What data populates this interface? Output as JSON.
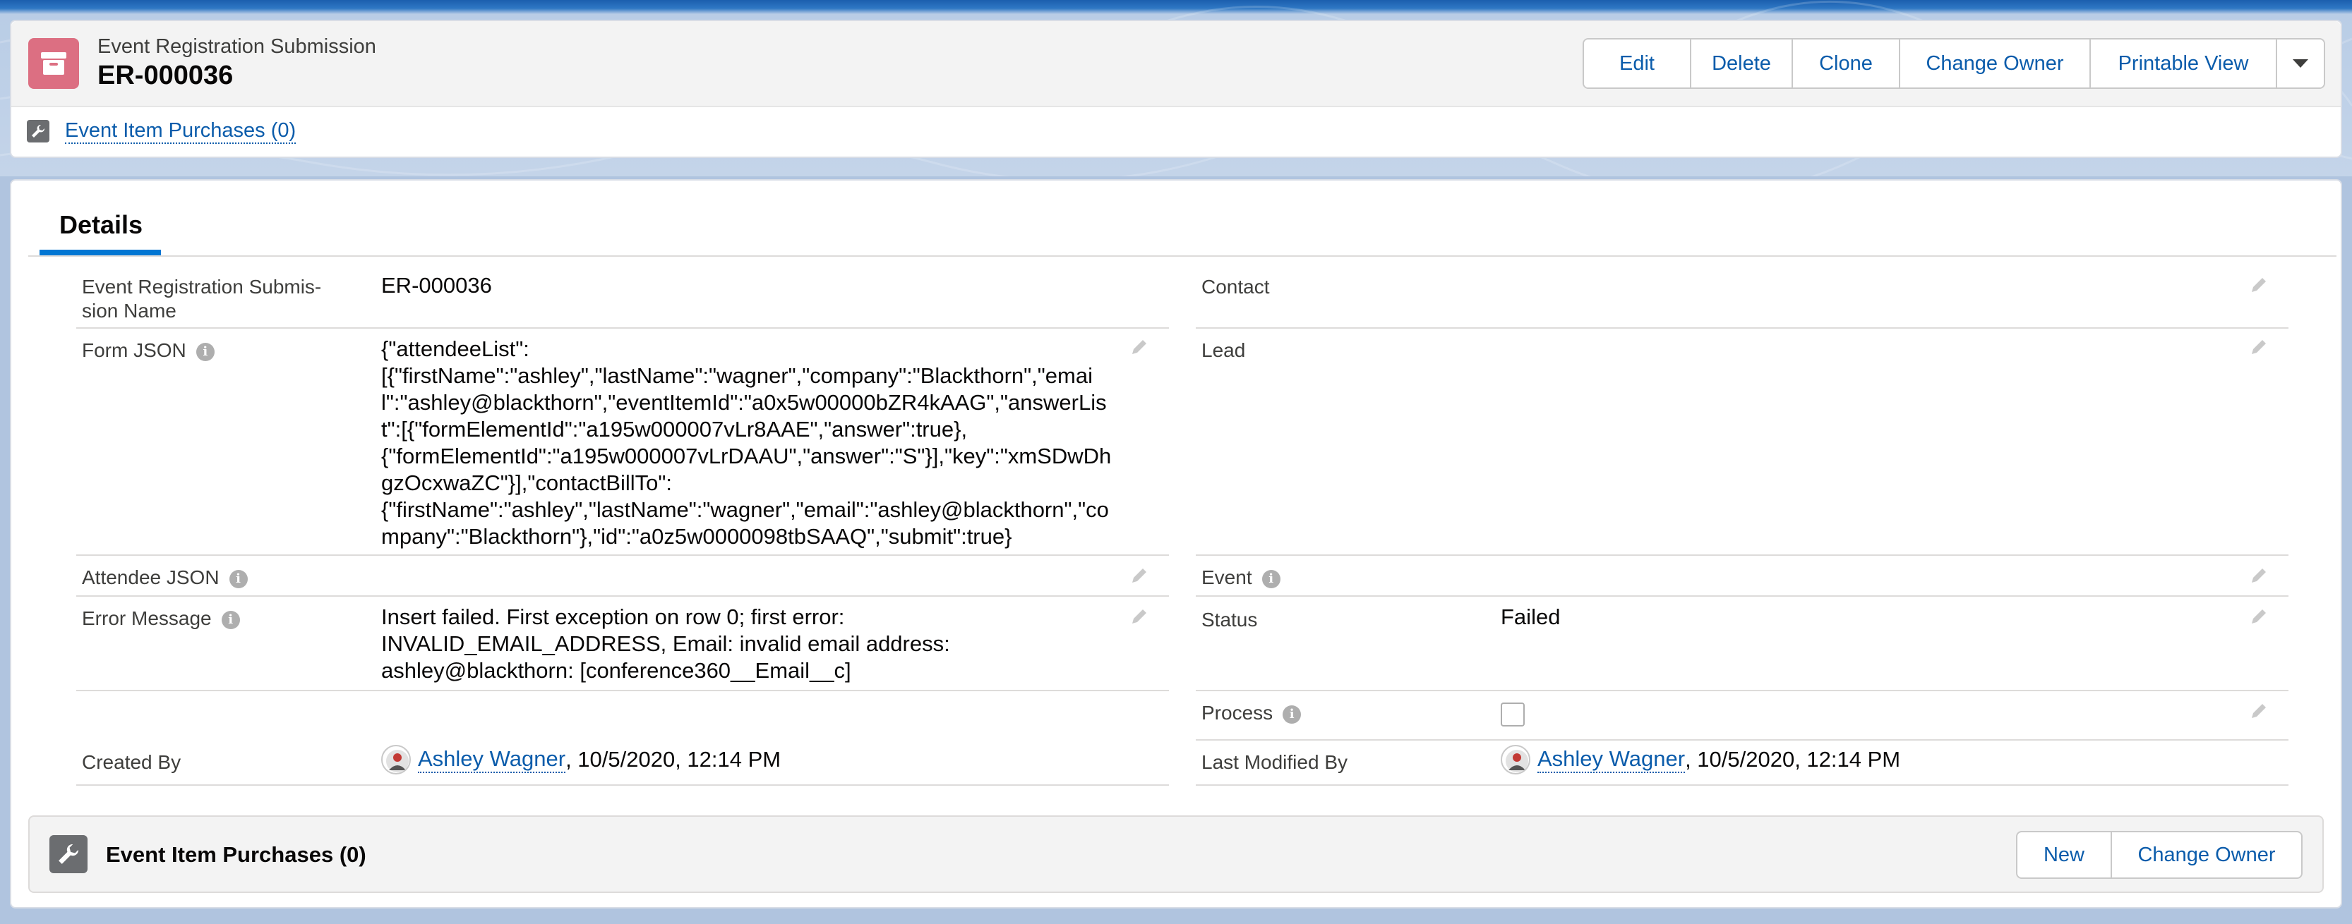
{
  "header": {
    "object_type": "Event Registration Submission",
    "record_name": "ER-000036",
    "icon": "archive-box-icon",
    "actions": [
      "Edit",
      "Delete",
      "Clone",
      "Change Owner",
      "Printable View"
    ],
    "more_icon": "chevron-down-icon",
    "quick_link": "Event Item Purchases (0)",
    "quick_link_icon": "wrench-icon"
  },
  "tabs": {
    "active": "Details"
  },
  "fields": {
    "submission_name": {
      "label": "Event Registration Submis-\nsion Name",
      "value": "ER-000036"
    },
    "form_json": {
      "label": "Form JSON",
      "value": "{\"attendeeList\":\n[{\"firstName\":\"ashley\",\"lastName\":\"wagner\",\"company\":\"Blackthorn\",\"email\":\"ashley@blackthorn\",\"eventItemId\":\"a0x5w00000bZR4kAAG\",\"answerList\":[{\"formElementId\":\"a195w000007vLr8AAE\",\"answer\":true},\n{\"formElementId\":\"a195w000007vLrDAAU\",\"answer\":\"S\"}],\"key\":\"xmSDwDhgzOcxwaZC\"}],\"contactBillTo\":\n{\"firstName\":\"ashley\",\"lastName\":\"wagner\",\"email\":\"ashley@blackthorn\",\"company\":\"Blackthorn\"},\"id\":\"a0z5w0000098tbSAAQ\",\"submit\":true}"
    },
    "attendee_json": {
      "label": "Attendee JSON",
      "value": ""
    },
    "error_message": {
      "label": "Error Message",
      "value": "Insert failed. First exception on row 0; first error: INVALID_EMAIL_ADDRESS, Email: invalid email address: ashley@blackthorn: [conference360__Email__c]"
    },
    "created_by": {
      "label": "Created By",
      "user": "Ashley Wagner",
      "date": ", 10/5/2020, 12:14 PM"
    },
    "contact": {
      "label": "Contact",
      "value": ""
    },
    "lead": {
      "label": "Lead",
      "value": ""
    },
    "event": {
      "label": "Event",
      "value": ""
    },
    "status": {
      "label": "Status",
      "value": "Failed"
    },
    "process": {
      "label": "Process",
      "checked": false
    },
    "last_modified_by": {
      "label": "Last Modified By",
      "user": "Ashley Wagner",
      "date": ", 10/5/2020, 12:14 PM"
    }
  },
  "related_list": {
    "title": "Event Item Purchases (0)",
    "icon": "wrench-icon",
    "actions": [
      "New",
      "Change Owner"
    ]
  },
  "colors": {
    "brand_blue": "#0176d3",
    "link": "#0b5cab",
    "object_icon": "#dc6f82"
  }
}
